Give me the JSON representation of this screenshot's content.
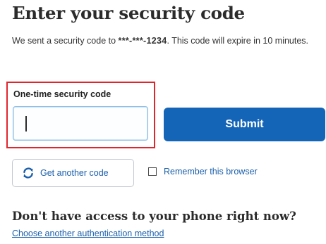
{
  "title": "Enter your security code",
  "intro": {
    "prefix": "We sent a security code to ",
    "masked_phone": "***-***-1234",
    "suffix": ". This code will expire in 10 minutes."
  },
  "code_field": {
    "label": "One-time security code",
    "value": "",
    "placeholder": "",
    "highlight_color": "#e0262d"
  },
  "submit": {
    "label": "Submit",
    "color": "#1465b8"
  },
  "another_code": {
    "label": "Get another code",
    "icon": "refresh-icon"
  },
  "remember_browser": {
    "label": "Remember this browser",
    "checked": false
  },
  "phone_access": {
    "heading": "Don't have access to your phone right now?",
    "link": "Choose another authentication method"
  },
  "colors": {
    "link": "#1a5fab",
    "input_border": "#8bbfe6"
  }
}
